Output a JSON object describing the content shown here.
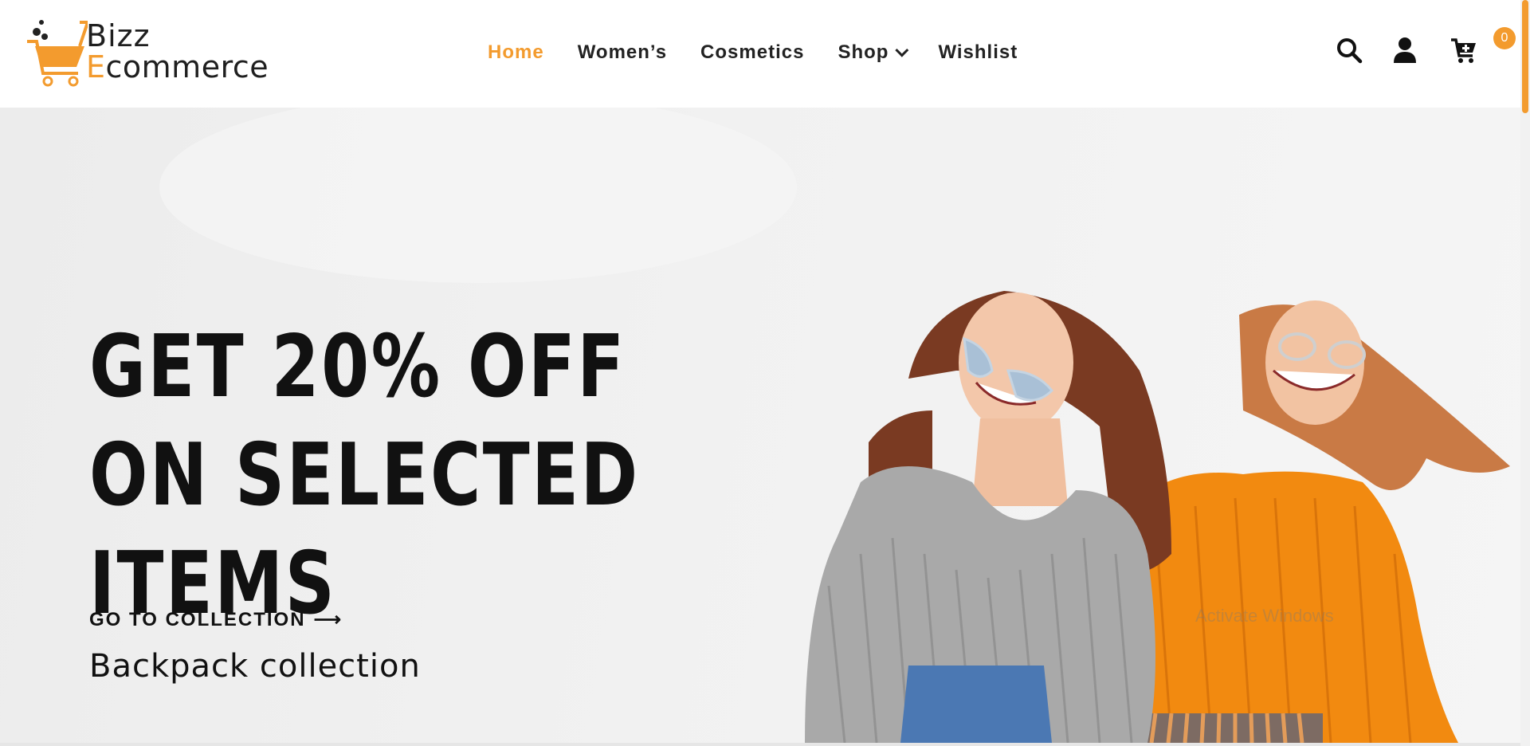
{
  "brand": {
    "line1": "Bizz",
    "line2_accent": "E",
    "line2_rest": "commerce"
  },
  "nav": {
    "items": [
      {
        "label": "Home",
        "active": true
      },
      {
        "label": "Women’s"
      },
      {
        "label": "Cosmetics"
      },
      {
        "label": "Shop"
      },
      {
        "label": "Wishlist"
      }
    ]
  },
  "header_icons": [
    "search-icon",
    "user-icon",
    "cart-icon"
  ],
  "cart": {
    "count": "0"
  },
  "hero": {
    "title_lines": [
      "GET 20% OFF",
      "ON SELECTED",
      "ITEMS"
    ],
    "subtitle": "Backpack collection",
    "cta": "GO TO COLLECTION",
    "cta_icon": "arrow-right-icon"
  },
  "watermark": "Activate Windows",
  "colors": {
    "accent": "#f39b2e",
    "text": "#111111",
    "hero_bg": "#efefef",
    "gray_sweater": "#a9a9a9",
    "orange_sweater": "#f28a10"
  }
}
